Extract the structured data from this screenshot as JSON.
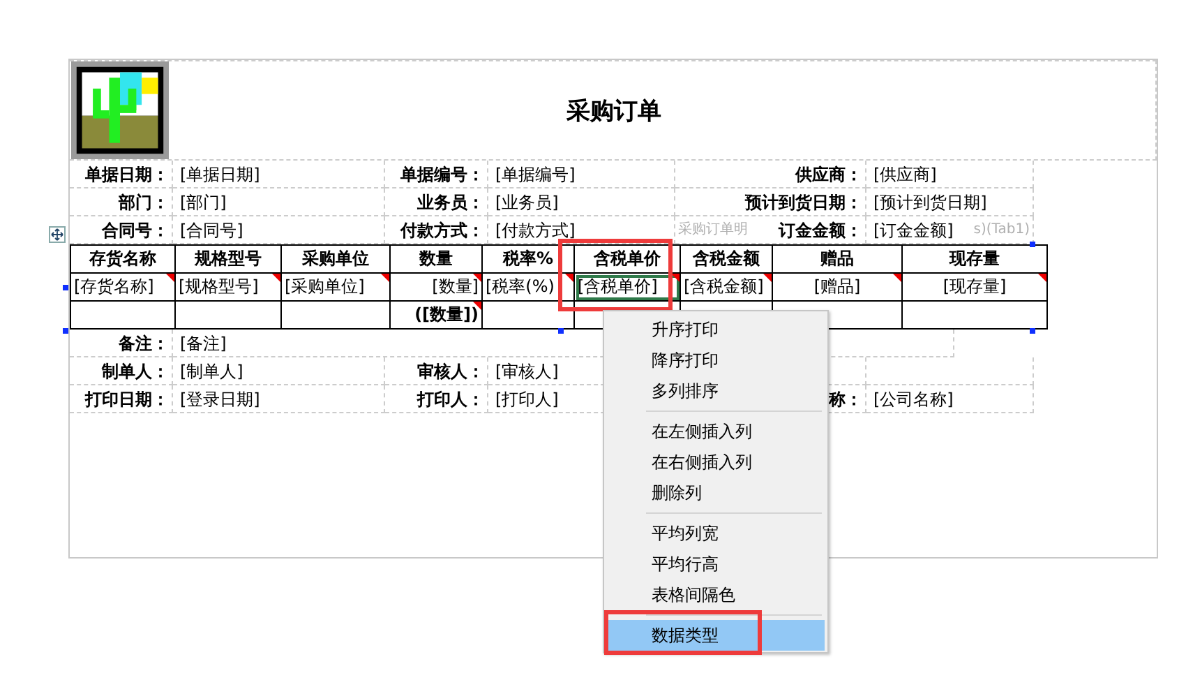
{
  "report": {
    "title": "采购订单",
    "info_rows": [
      [
        {
          "label": "单据日期：",
          "value": "[单据日期]"
        },
        {
          "label": "单据编号：",
          "value": "[单据编号]"
        },
        {
          "label": "供应商：",
          "value": "[供应商]"
        }
      ],
      [
        {
          "label": "部门：",
          "value": "[部门]"
        },
        {
          "label": "业务员：",
          "value": "[业务员]"
        },
        {
          "label": "预计到货日期：",
          "value": "[预计到货日期]"
        }
      ],
      [
        {
          "label": "合同号：",
          "value": "[合同号]"
        },
        {
          "label": "付款方式：",
          "value": "[付款方式]"
        },
        {
          "label": "订金金额：",
          "value": "[订金金额]"
        }
      ]
    ],
    "table_caption": {
      "head": "采购订单明",
      "tail": "s)(Tab1)"
    },
    "table": {
      "columns": [
        "存货名称",
        "规格型号",
        "采购单位",
        "数量",
        "税率%",
        "含税单价",
        "含税金额",
        "赠品",
        "现存量"
      ],
      "rows": [
        [
          {
            "text": "[存货名称]",
            "flagged": true,
            "selected": false
          },
          {
            "text": "[规格型号]",
            "flagged": true,
            "selected": false
          },
          {
            "text": "[采购单位]",
            "flagged": true,
            "selected": false
          },
          {
            "text": "[数量]",
            "flagged": true,
            "selected": false
          },
          {
            "text": "[税率(%)",
            "flagged": true,
            "selected": false
          },
          {
            "text": "[含税单价]",
            "flagged": true,
            "selected": true
          },
          {
            "text": "[含税金额]",
            "flagged": true,
            "selected": false
          },
          {
            "text": "[赠品]",
            "flagged": true,
            "selected": false
          },
          {
            "text": "[现存量]",
            "flagged": true,
            "selected": false
          }
        ],
        [
          {
            "flagged": false,
            "selected": false
          },
          {
            "flagged": false,
            "selected": false
          },
          {
            "flagged": false,
            "selected": false
          },
          {
            "text": "([数量])",
            "flagged": true,
            "selected": false
          },
          {
            "flagged": false,
            "selected": false
          },
          {
            "flagged": false,
            "selected": false
          },
          {
            "flagged": false,
            "selected": false
          },
          {
            "flagged": false,
            "selected": false
          },
          {
            "flagged": false,
            "selected": false
          }
        ]
      ]
    },
    "remark": {
      "label": "备注：",
      "value": "[备注]"
    },
    "footer_rows": [
      [
        {
          "label": "制单人：",
          "value": "[制单人]"
        },
        {
          "label": "审核人：",
          "value": "[审核人]"
        }
      ],
      [
        {
          "label": "打印日期：",
          "value": "[登录日期]"
        },
        {
          "label": "打印人：",
          "value": "[打印人]"
        },
        {
          "label": "称：",
          "value": "[公司名称]"
        }
      ]
    ]
  },
  "context_menu": [
    [
      {
        "label": "升序打印",
        "selected": false
      },
      {
        "label": "降序打印",
        "selected": false
      },
      {
        "label": "多列排序",
        "selected": false
      }
    ],
    [
      {
        "label": "在左侧插入列",
        "selected": false
      },
      {
        "label": "在右侧插入列",
        "selected": false
      },
      {
        "label": "删除列",
        "selected": false
      }
    ],
    [
      {
        "label": "平均列宽",
        "selected": false
      },
      {
        "label": "平均行高",
        "selected": false
      },
      {
        "label": "表格间隔色",
        "selected": false
      }
    ],
    [
      {
        "label": "数据类型",
        "selected": true
      }
    ]
  ]
}
